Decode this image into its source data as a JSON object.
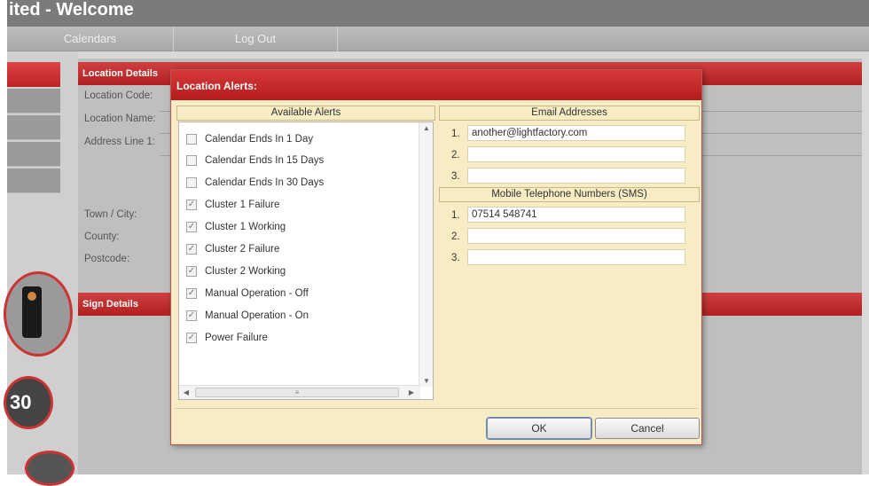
{
  "app": {
    "title": "ited - Welcome",
    "nav": [
      {
        "label": "Calendars"
      },
      {
        "label": "Log Out"
      }
    ],
    "location_section": "Location Details",
    "fields": [
      {
        "label": "Location Code:"
      },
      {
        "label": "Location Name:"
      },
      {
        "label": "Address Line 1:"
      },
      {
        "label": "Town / City:"
      },
      {
        "label": "County:"
      },
      {
        "label": "Postcode:"
      }
    ],
    "sign_section": "Sign Details",
    "counter_text": "30"
  },
  "dialog": {
    "title": "Location Alerts:",
    "alerts_header": "Available Alerts",
    "alerts": [
      {
        "label": "Calendar Ends In 1 Day",
        "checked": false
      },
      {
        "label": "Calendar Ends In 15 Days",
        "checked": false
      },
      {
        "label": "Calendar Ends In 30 Days",
        "checked": false
      },
      {
        "label": "Cluster 1 Failure",
        "checked": true
      },
      {
        "label": "Cluster 1 Working",
        "checked": true
      },
      {
        "label": "Cluster 2 Failure",
        "checked": true
      },
      {
        "label": "Cluster 2 Working",
        "checked": true
      },
      {
        "label": "Manual Operation - Off",
        "checked": true
      },
      {
        "label": "Manual Operation - On",
        "checked": true
      },
      {
        "label": "Power Failure",
        "checked": true
      }
    ],
    "email_header": "Email Addresses",
    "emails": [
      {
        "num": "1.",
        "value": "another@lightfactory.com"
      },
      {
        "num": "2.",
        "value": ""
      },
      {
        "num": "3.",
        "value": ""
      }
    ],
    "sms_header": "Mobile Telephone Numbers (SMS)",
    "sms": [
      {
        "num": "1.",
        "value": "07514 548741"
      },
      {
        "num": "2.",
        "value": ""
      },
      {
        "num": "3.",
        "value": ""
      }
    ],
    "ok_label": "OK",
    "cancel_label": "Cancel"
  }
}
